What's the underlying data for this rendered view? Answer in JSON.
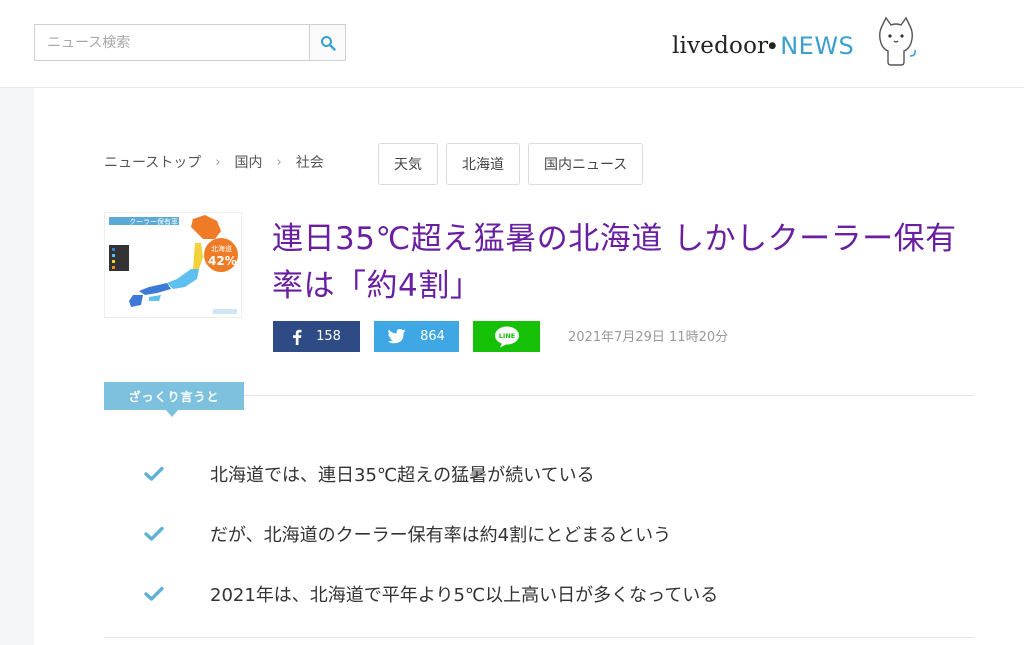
{
  "search": {
    "placeholder": "ニュース検索"
  },
  "logo": {
    "word": "livedoor",
    "dot": "●",
    "news": "NEWS"
  },
  "breadcrumb": {
    "items": [
      "ニューストップ",
      "国内",
      "社会"
    ],
    "sep": "›"
  },
  "tags": [
    "天気",
    "北海道",
    "国内ニュース"
  ],
  "thumbnail": {
    "header_text": "クーラー保有率",
    "badge_region": "北海道",
    "badge_value": "42%"
  },
  "article": {
    "title": "連日35℃超え猛暑の北海道 しかしクーラー保有率は「約4割」",
    "date": "2021年7月29日 11時20分"
  },
  "share": {
    "facebook_count": "158",
    "twitter_count": "864",
    "line_label": "LINE"
  },
  "summary": {
    "label": "ざっくり言うと",
    "points": [
      "北海道では、連日35℃超えの猛暑が続いている",
      "だが、北海道のクーラー保有率は約4割にとどまるという",
      "2021年は、北海道で平年より5℃以上高い日が多くなっている"
    ]
  },
  "colors": {
    "title": "#6a1fa0",
    "facebook": "#2e4b86",
    "twitter": "#3fa7e4",
    "line": "#16c007",
    "accent": "#7ec1de",
    "check": "#5eb2d8"
  }
}
